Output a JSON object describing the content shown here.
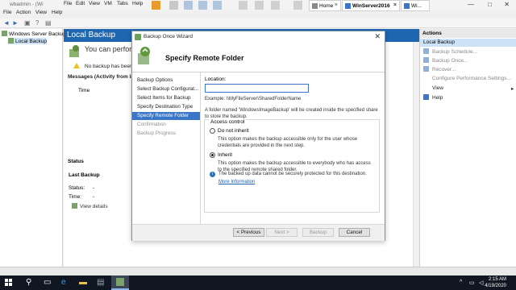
{
  "vm": {
    "title": "wbadmin - (Wi",
    "menu": [
      "File",
      "Action",
      "View",
      "Help",
      "File",
      "Edit",
      "View",
      "VM",
      "Tabs",
      "Help"
    ],
    "tabs": [
      {
        "label": "Home"
      },
      {
        "label": "WinServer2016"
      },
      {
        "label": "Wi..."
      }
    ],
    "window_controls": [
      "—",
      "□",
      "✕"
    ]
  },
  "tree": {
    "items": [
      {
        "label": "Windows Server Backup (L"
      },
      {
        "label": "Local Backup"
      }
    ]
  },
  "center": {
    "header": "Local Backup",
    "intro": "You can perform",
    "warning": "No backup has been co",
    "messages_title": "Messages (Activity from last w",
    "col_time": "Time",
    "status_title": "Status",
    "last_backup": "Last Backup",
    "status_label": "Status:",
    "status_value": "-",
    "time_label": "Time:",
    "time_value": "-",
    "view_details": "View details"
  },
  "actions": {
    "header": "Actions",
    "sub": "Local Backup",
    "items": [
      {
        "label": "Backup Schedule..."
      },
      {
        "label": "Backup Once..."
      },
      {
        "label": "Recover..."
      },
      {
        "label": "Configure Performance Settings..."
      },
      {
        "label": "View"
      },
      {
        "label": "Help"
      }
    ]
  },
  "wizard": {
    "title": "Backup Once Wizard",
    "heading": "Specify Remote Folder",
    "close": "✕",
    "steps": [
      {
        "label": "Backup Options"
      },
      {
        "label": "Select Backup Configurat..."
      },
      {
        "label": "Select Items for Backup"
      },
      {
        "label": "Specify Destination Type"
      },
      {
        "label": "Specify Remote Folder"
      },
      {
        "label": "Confirmation"
      },
      {
        "label": "Backup Progress"
      }
    ],
    "location_label": "Location:",
    "location_value": "",
    "example": "Example: \\\\MyFileServer\\SharedFolderName",
    "folder_note": "A folder named 'WindowsImageBackup' will be created inside the specified share to store the backup.",
    "access_control": "Access control",
    "option1_label": "Do not inherit",
    "option1_desc": "This option makes the backup accessible only for the user whose credentials are provided in the next step.",
    "option2_label": "Inherit",
    "option2_desc": "This option makes the backup accessible to everybody who has access to the specified remote shared folder.",
    "info": "The backed up data cannot be securely protected for this destination.",
    "more_info": "More Information",
    "buttons": {
      "previous": "< Previous",
      "next": "Next >",
      "backup": "Backup",
      "cancel": "Cancel"
    }
  },
  "taskbar": {
    "time": "2:15 AM",
    "date": "4/19/2020"
  }
}
